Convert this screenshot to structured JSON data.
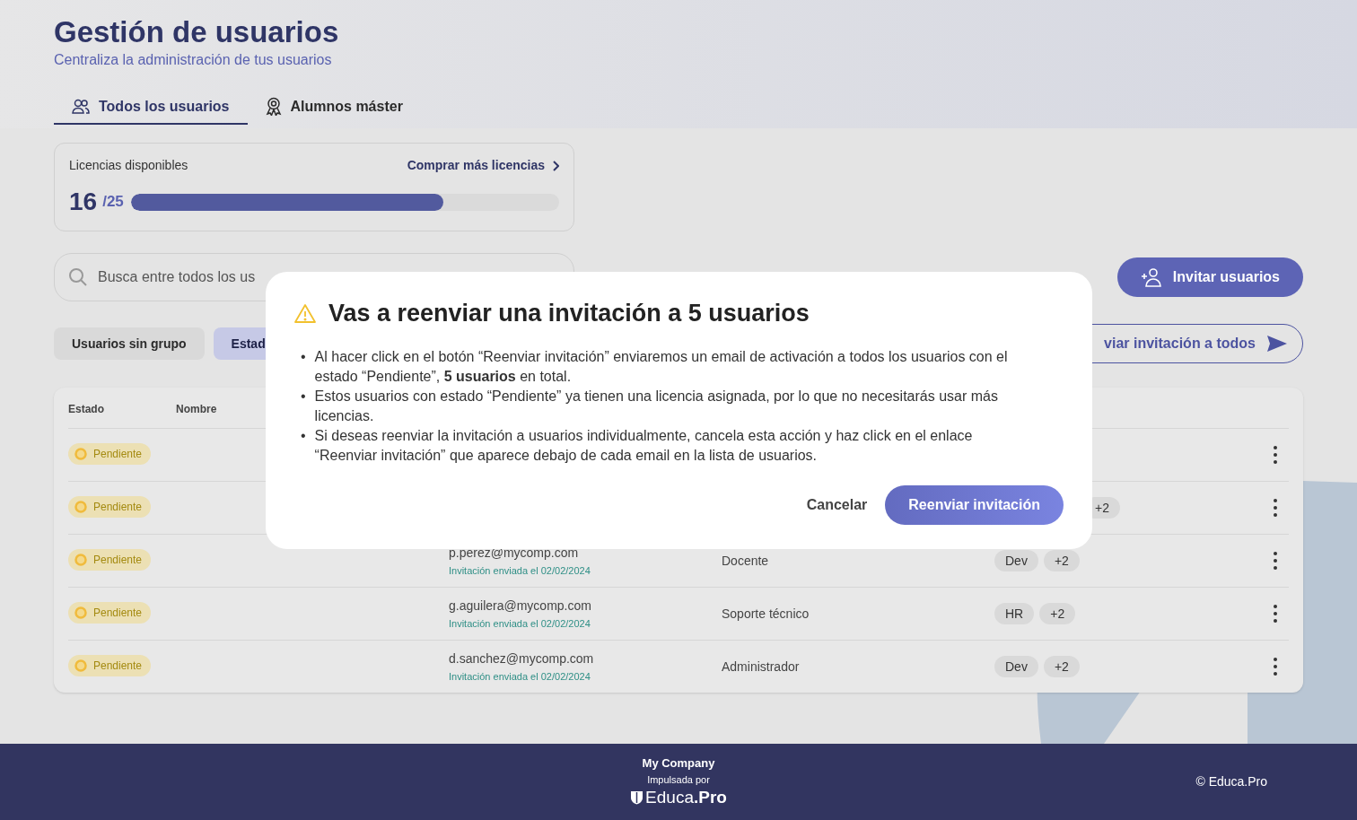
{
  "header": {
    "title": "Gestión de usuarios",
    "subtitle": "Centraliza la administración de tus usuarios"
  },
  "tabs": [
    {
      "label": "Todos los usuarios",
      "selected": true
    },
    {
      "label": "Alumnos máster",
      "selected": false
    }
  ],
  "licenses": {
    "label": "Licencias disponibles",
    "link": "Comprar más licencias",
    "used": "16",
    "total": "/25",
    "level": 0.73
  },
  "search": {
    "placeholder": "Busca entre todos los us"
  },
  "filters": [
    {
      "label": "Usuarios sin grupo",
      "selected": false
    },
    {
      "label": "Estad",
      "selected": true
    }
  ],
  "actions": {
    "invite": "Invitar usuarios",
    "resend_all": "viar invitación a todos"
  },
  "table": {
    "columns": [
      "Estado",
      "Nombre"
    ],
    "rows": [
      {
        "status": "Pendiente"
      },
      {
        "status": "Pendiente",
        "tags": [
          "+2"
        ]
      },
      {
        "status": "Pendiente",
        "email": "p.perez@mycomp.com",
        "sent": "Invitación enviada el 02/02/2024",
        "role": "Docente",
        "tags": [
          "Dev",
          "+2"
        ]
      },
      {
        "status": "Pendiente",
        "email": "g.aguilera@mycomp.com",
        "sent": "Invitación enviada el 02/02/2024",
        "role": "Soporte técnico",
        "tags": [
          "HR",
          "+2"
        ]
      },
      {
        "status": "Pendiente",
        "email": "d.sanchez@mycomp.com",
        "sent": "Invitación enviada el 02/02/2024",
        "role": "Administrador",
        "tags": [
          "Dev",
          "+2"
        ]
      }
    ]
  },
  "modal": {
    "title": "Vas a reenviar una invitación a 5 usuarios",
    "bullet": "•",
    "items": [
      "Al hacer click en el botón “Reenviar invitación” enviaremos un email de activación a todos los usuarios con el estado “Pendiente”, **5 usuarios** en total.",
      "Estos usuarios con estado “Pendiente” ya tienen una licencia asignada, por lo que no necesitarás usar más licencias.",
      "Si deseas reenviar la invitación a usuarios individualmente, cancela esta acción y haz click en el enlace “Reenviar invitación” que aparece debajo de cada email en la lista de usuarios."
    ],
    "cancel": "Cancelar",
    "confirm": "Reenviar invitación"
  },
  "footer": {
    "company": "My Company",
    "powered_by": "Impulsada por",
    "brand": "Educa**.Pro**",
    "copyright": "© Educa.Pro"
  }
}
